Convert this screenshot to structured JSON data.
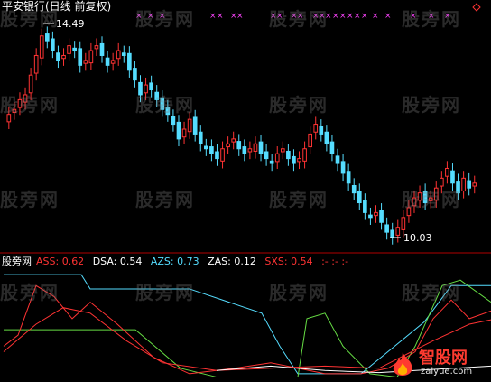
{
  "title": "平安银行(日线 前复权)",
  "watermark": "股旁网",
  "annotations": {
    "high": "14.49",
    "low": "10.03"
  },
  "indicator": {
    "name": "股旁网",
    "items": [
      {
        "key": "ASS",
        "label": "ASS: 0.62",
        "color": "#ff3333"
      },
      {
        "key": "DSA",
        "label": "DSA: 0.54",
        "color": "#ffffff"
      },
      {
        "key": "AZS",
        "label": "AZS: 0.73",
        "color": "#55ddff"
      },
      {
        "key": "ZAS",
        "label": "ZAS: 0.12",
        "color": "#ffffff"
      },
      {
        "key": "SXS",
        "label": "SXS: 0.54",
        "color": "#ff3333"
      },
      {
        "key": "extra",
        "label": ":- :- :-",
        "color": "#ff3333"
      }
    ]
  },
  "brand": {
    "name": "智股网",
    "url": "zalyue.com"
  },
  "colors": {
    "up": "#ff3333",
    "down": "#55ddff",
    "marker": "#ff44ff",
    "line_green": "#66dd44",
    "line_cyan": "#55ddff",
    "line_red": "#ff3333",
    "line_white": "#ffffff"
  },
  "chart_data": [
    {
      "type": "candlestick",
      "title": "平安银行(日线 前复权)",
      "ylim": [
        10.0,
        14.6
      ],
      "annotations": [
        {
          "label": "14.49",
          "value": 14.49
        },
        {
          "label": "10.03",
          "value": 10.03
        }
      ],
      "close": [
        12.6,
        12.7,
        12.9,
        13.0,
        13.4,
        13.8,
        14.2,
        14.1,
        13.9,
        13.7,
        13.8,
        14.0,
        13.9,
        13.6,
        13.7,
        13.9,
        14.0,
        13.8,
        13.6,
        13.7,
        13.9,
        13.8,
        13.5,
        13.3,
        13.0,
        13.2,
        13.1,
        12.9,
        12.7,
        12.6,
        12.4,
        12.1,
        12.3,
        12.5,
        12.2,
        12.0,
        11.9,
        11.8,
        11.7,
        11.9,
        12.0,
        12.1,
        11.9,
        11.8,
        11.9,
        12.0,
        11.8,
        11.7,
        11.6,
        11.8,
        11.9,
        11.7,
        11.6,
        11.7,
        11.9,
        12.2,
        12.4,
        12.2,
        12.0,
        11.8,
        11.6,
        11.4,
        11.2,
        11.0,
        10.8,
        10.6,
        10.5,
        10.6,
        10.4,
        10.2,
        10.1,
        10.3,
        10.5,
        10.7,
        10.9,
        11.0,
        10.8,
        10.9,
        11.1,
        11.3,
        11.5,
        11.2,
        11.0,
        11.3,
        11.1,
        11.2
      ],
      "markers_top": "magenta crosses along top of price panel"
    },
    {
      "type": "line",
      "series": [
        {
          "name": "ASS",
          "value_last": 0.62
        },
        {
          "name": "DSA",
          "value_last": 0.54
        },
        {
          "name": "AZS",
          "value_last": 0.73
        },
        {
          "name": "ZAS",
          "value_last": 0.12
        },
        {
          "name": "SXS",
          "value_last": 0.54
        }
      ],
      "ylim": [
        0,
        1
      ]
    }
  ]
}
